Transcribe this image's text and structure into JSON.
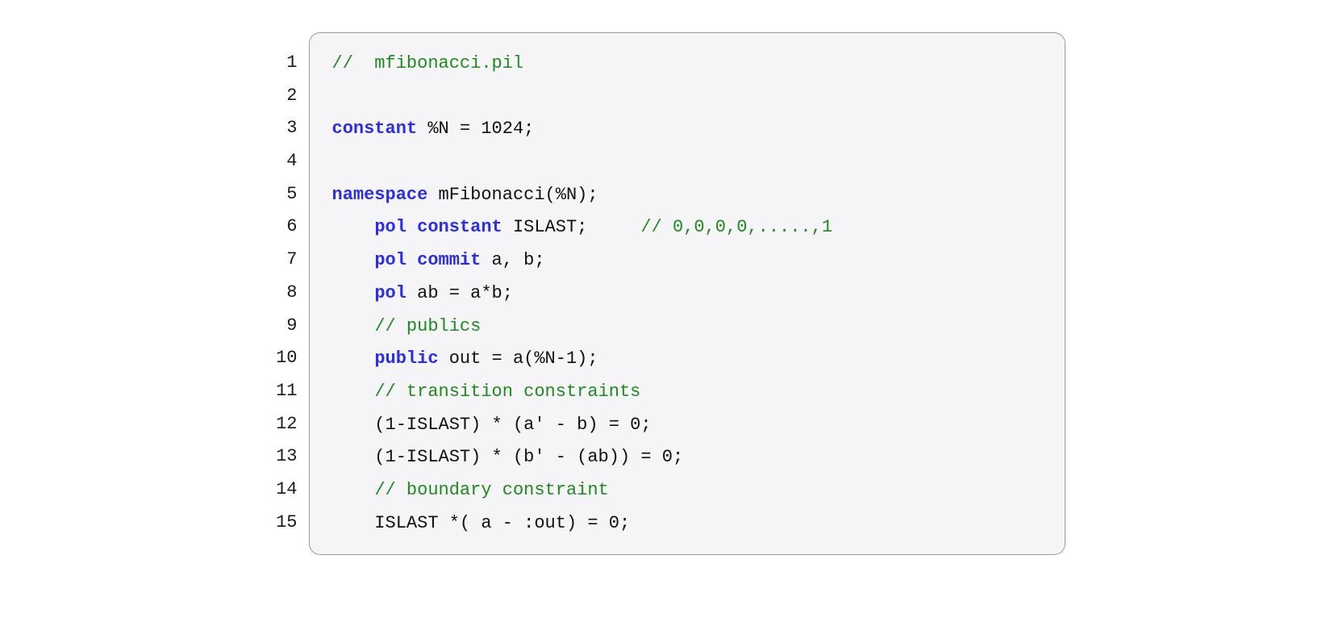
{
  "lines": [
    {
      "num": "1",
      "tokens": [
        [
          "cm",
          "//  mfibonacci.pil"
        ]
      ]
    },
    {
      "num": "2",
      "tokens": [
        [
          "pl",
          ""
        ]
      ]
    },
    {
      "num": "3",
      "tokens": [
        [
          "kw",
          "constant"
        ],
        [
          "pl",
          " %N = 1024;"
        ]
      ]
    },
    {
      "num": "4",
      "tokens": [
        [
          "pl",
          ""
        ]
      ]
    },
    {
      "num": "5",
      "tokens": [
        [
          "kw",
          "namespace"
        ],
        [
          "pl",
          " mFibonacci(%N);"
        ]
      ]
    },
    {
      "num": "6",
      "tokens": [
        [
          "pl",
          "    "
        ],
        [
          "kw",
          "pol constant"
        ],
        [
          "pl",
          " ISLAST;     "
        ],
        [
          "cm",
          "// 0,0,0,0,.....,1"
        ]
      ]
    },
    {
      "num": "7",
      "tokens": [
        [
          "pl",
          "    "
        ],
        [
          "kw",
          "pol commit"
        ],
        [
          "pl",
          " a, b;"
        ]
      ]
    },
    {
      "num": "8",
      "tokens": [
        [
          "pl",
          "    "
        ],
        [
          "kw",
          "pol"
        ],
        [
          "pl",
          " ab = a*b;"
        ]
      ]
    },
    {
      "num": "9",
      "tokens": [
        [
          "pl",
          "    "
        ],
        [
          "cm",
          "// publics"
        ]
      ]
    },
    {
      "num": "10",
      "tokens": [
        [
          "pl",
          "    "
        ],
        [
          "kw",
          "public"
        ],
        [
          "pl",
          " out = a(%N-1);"
        ]
      ]
    },
    {
      "num": "11",
      "tokens": [
        [
          "pl",
          "    "
        ],
        [
          "cm",
          "// transition constraints"
        ]
      ]
    },
    {
      "num": "12",
      "tokens": [
        [
          "pl",
          "    (1-ISLAST) * (a' - b) = 0;"
        ]
      ]
    },
    {
      "num": "13",
      "tokens": [
        [
          "pl",
          "    (1-ISLAST) * (b' - (ab)) = 0;"
        ]
      ]
    },
    {
      "num": "14",
      "tokens": [
        [
          "pl",
          "    "
        ],
        [
          "cm",
          "// boundary constraint"
        ]
      ]
    },
    {
      "num": "15",
      "tokens": [
        [
          "pl",
          "    ISLAST *( a - :out) = 0;"
        ]
      ]
    }
  ]
}
